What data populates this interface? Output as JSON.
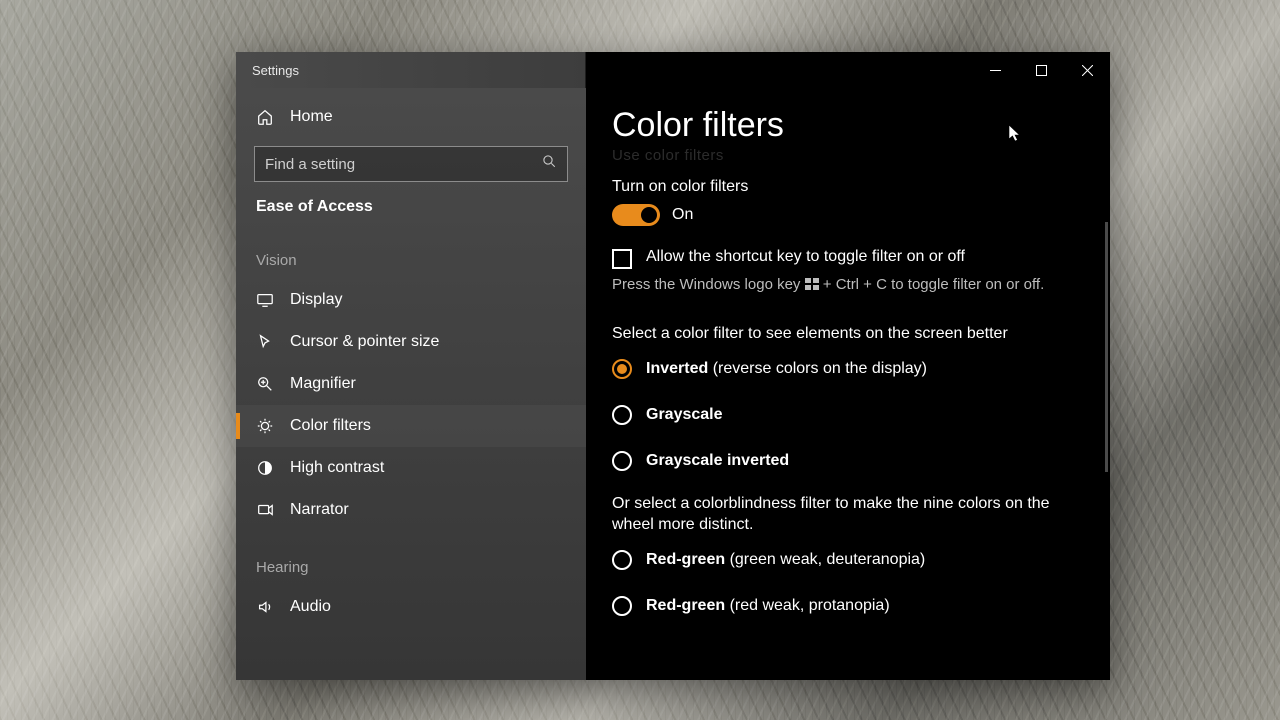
{
  "window": {
    "title": "Settings"
  },
  "sidebar": {
    "home": "Home",
    "search_placeholder": "Find a setting",
    "category": "Ease of Access",
    "sections": {
      "vision": "Vision",
      "hearing": "Hearing"
    },
    "items": {
      "display": "Display",
      "cursor": "Cursor & pointer size",
      "magnifier": "Magnifier",
      "color_filters": "Color filters",
      "high_contrast": "High contrast",
      "narrator": "Narrator",
      "audio": "Audio"
    }
  },
  "page": {
    "title": "Color filters",
    "ghost": "Use color filters",
    "turn_on_label": "Turn on color filters",
    "toggle_state": "On",
    "shortcut_checkbox": "Allow the shortcut key to toggle filter on or off",
    "shortcut_hint_pre": "Press the Windows logo key ",
    "shortcut_hint_post": " + Ctrl + C to toggle filter on or off.",
    "select_label": "Select a color filter to see elements on the screen better",
    "options": {
      "inverted_b": "Inverted",
      "inverted_p": " (reverse colors on the display)",
      "grayscale": "Grayscale",
      "grayscale_inv": "Grayscale inverted"
    },
    "cb_label": "Or select a colorblindness filter to make the nine colors on the wheel more distinct.",
    "cb_options": {
      "deut_b": "Red-green",
      "deut_p": " (green weak, deuteranopia)",
      "prot_b": "Red-green",
      "prot_p": " (red weak, protanopia)"
    }
  },
  "colors": {
    "accent": "#e88b1c"
  }
}
